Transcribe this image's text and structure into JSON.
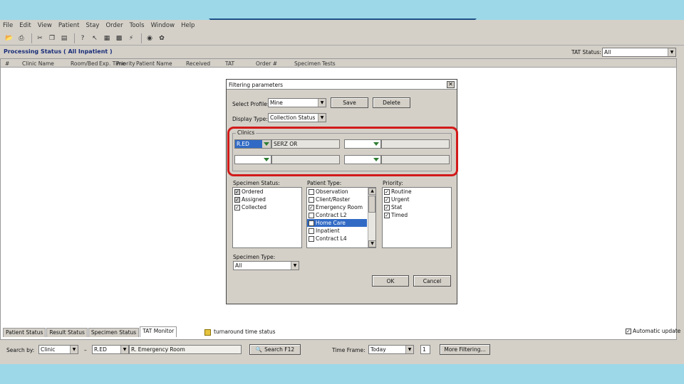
{
  "menu": [
    "File",
    "Edit",
    "View",
    "Patient",
    "Stay",
    "Order",
    "Tools",
    "Window",
    "Help"
  ],
  "toolbar_icons": [
    "open-icon",
    "print-icon",
    "cut-icon",
    "copy-icon",
    "paste-icon",
    "help-icon",
    "whats-this-icon",
    "tool-icon-1",
    "tool-icon-2",
    "tool-icon-3",
    "tool-icon-4"
  ],
  "processing_status": {
    "title": "Processing Status ( All Inpatient )",
    "tat_status_label": "TAT Status:",
    "tat_status_value": "All"
  },
  "grid": {
    "columns": [
      "#",
      "Clinic Name",
      "Room/Bed",
      "Exp. Time",
      "Priority",
      "Patient Name",
      "Received",
      "TAT",
      "Order #",
      "Specimen",
      "Tests"
    ]
  },
  "tabs": [
    "Patient Status",
    "Result Status",
    "Specimen Status",
    "TAT Monitor"
  ],
  "tat_status_text": "turnaround time status",
  "auto_update": "Automatic update",
  "search": {
    "search_by_label": "Search by:",
    "search_by_value": "Clinic",
    "clinic_code": "R.ED",
    "clinic_name": "R. Emergency Room",
    "search_button": "Search F12",
    "time_frame_label": "Time Frame:",
    "time_frame_value": "Today",
    "time_frame_num": "1",
    "more_filtering": "More Filtering..."
  },
  "dialog": {
    "title": "Filtering parameters",
    "select_profile_label": "Select Profile:",
    "select_profile_value": "Mine",
    "save_button": "Save",
    "delete_button": "Delete",
    "display_type_label": "Display Type:",
    "display_type_value": "Collection Status",
    "clinics_label": "Clinics",
    "clinic1_code": "R.ED",
    "clinic1_name": "SERZ OR",
    "specimen_status_label": "Specimen Status:",
    "specimen_status": [
      {
        "label": "Ordered",
        "checked": true
      },
      {
        "label": "Assigned",
        "checked": true
      },
      {
        "label": "Collected",
        "checked": true
      }
    ],
    "patient_type_label": "Patient Type:",
    "patient_type": [
      {
        "label": "Observation",
        "checked": false
      },
      {
        "label": "Client/Roster",
        "checked": false
      },
      {
        "label": "Emergency Room",
        "checked": true
      },
      {
        "label": "Contract L2",
        "checked": false
      },
      {
        "label": "Home Care",
        "checked": false,
        "selected": true
      },
      {
        "label": "Inpatient",
        "checked": false
      },
      {
        "label": "Contract L4",
        "checked": false
      }
    ],
    "priority_label": "Priority:",
    "priority": [
      {
        "label": "Routine",
        "checked": true
      },
      {
        "label": "Urgent",
        "checked": true
      },
      {
        "label": "Stat",
        "checked": true
      },
      {
        "label": "Timed",
        "checked": true
      }
    ],
    "specimen_type_label": "Specimen Type:",
    "specimen_type_value": "All",
    "ok_button": "OK",
    "cancel_button": "Cancel"
  },
  "colors": {
    "title_blue": "#1a2e7a",
    "highlight_red": "#d21a1a",
    "selection_blue": "#316ac5",
    "background": "#9dd8e8"
  }
}
